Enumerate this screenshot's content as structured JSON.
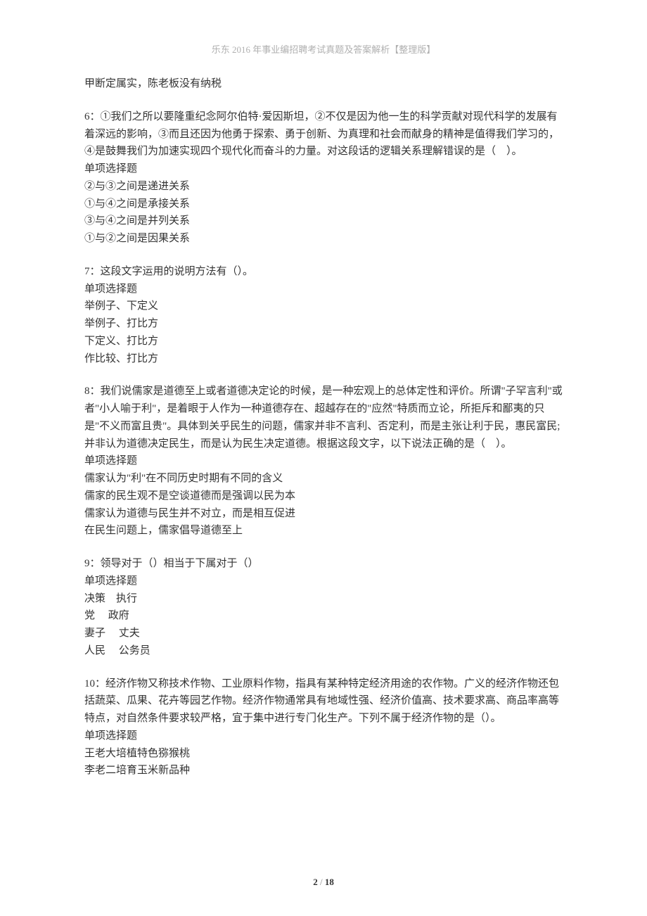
{
  "header": "乐东 2016 年事业编招聘考试真题及答案解析【整理版】",
  "carryover": "甲断定属实，陈老板没有纳税",
  "questions": [
    {
      "stem": "6：①我们之所以要隆重纪念阿尔伯特·爱因斯坦，②不仅是因为他一生的科学贡献对现代科学的发展有着深远的影响，③而且还因为他勇于探索、勇于创新、为真理和社会而献身的精神是值得我们学习的，④是鼓舞我们为加速实现四个现代化而奋斗的力量。对这段话的逻辑关系理解错误的是（　）。",
      "type": "单项选择题",
      "options": [
        "②与③之间是递进关系",
        "①与④之间是承接关系",
        "③与④之间是并列关系",
        "①与②之间是因果关系"
      ]
    },
    {
      "stem": "7：这段文字运用的说明方法有（）。",
      "type": "单项选择题",
      "options": [
        "举例子、下定义",
        "举例子、打比方",
        "下定义、打比方",
        "作比较、打比方"
      ]
    },
    {
      "stem": "8：我们说儒家是道德至上或者道德决定论的时候，是一种宏观上的总体定性和评价。所谓\"子罕言利\"或者\"小人喻于利\"，是着眼于人作为一种道德存在、超越存在的\"应然\"特质而立论，所拒斥和鄙夷的只是\"不义而富且贵\"。具体到关乎民生的问题，儒家并非不言利、否定利，而是主张让利于民，惠民富民;并非认为道德决定民生，而是认为民生决定道德。根据这段文字，以下说法正确的是（　）。",
      "type": "单项选择题",
      "options": [
        "儒家认为\"利\"在不同历史时期有不同的含义",
        "儒家的民生观不是空谈道德而是强调以民为本",
        "儒家认为道德与民生并不对立，而是相互促进",
        "在民生问题上，儒家倡导道德至上"
      ]
    },
    {
      "stem": "9：领导对于（）相当于下属对于（）",
      "type": "单项选择题",
      "options": [
        "决策　执行",
        "党　 政府",
        "妻子　 丈夫",
        "人民　 公务员"
      ]
    },
    {
      "stem": "10：经济作物又称技术作物、工业原料作物，指具有某种特定经济用途的农作物。广义的经济作物还包括蔬菜、瓜果、花卉等园艺作物。经济作物通常具有地域性强、经济价值高、技术要求高、商品率高等特点，对自然条件要求较严格，宜于集中进行专门化生产。下列不属于经济作物的是（）。",
      "type": "单项选择题",
      "options": [
        "王老大培植特色猕猴桃",
        "李老二培育玉米新品种"
      ]
    }
  ],
  "footer": {
    "page": "2",
    "sep": " / ",
    "total": "18"
  }
}
